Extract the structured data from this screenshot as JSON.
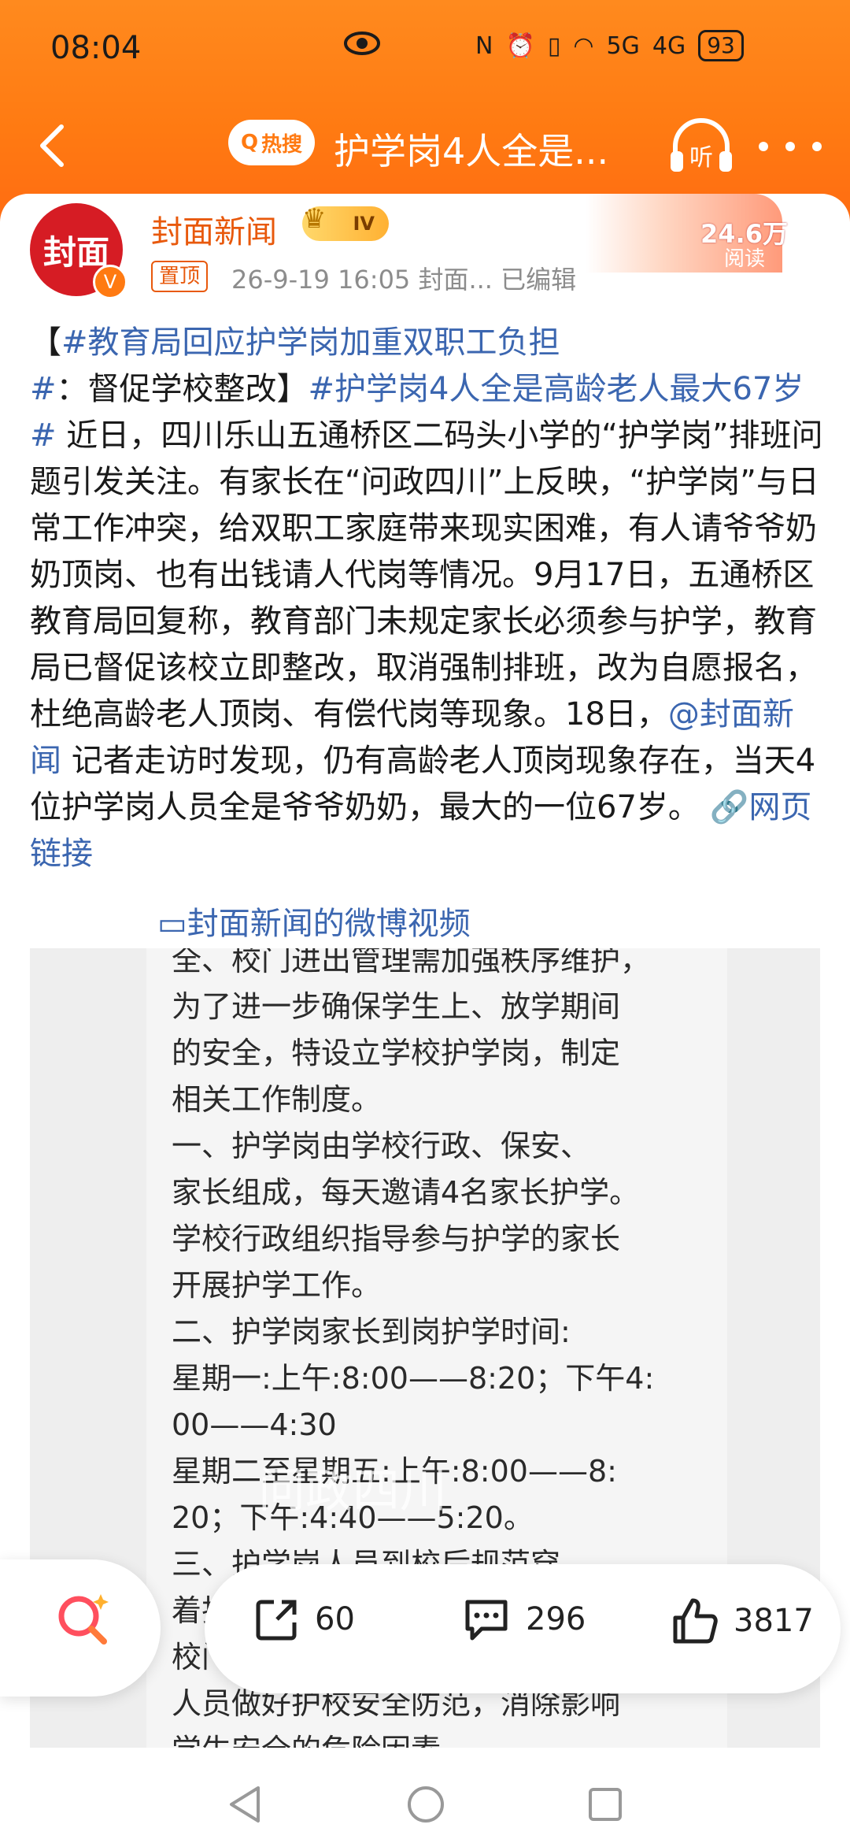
{
  "status_bar": {
    "time": "08:04",
    "net1": "5G",
    "net2": "4G",
    "battery": "93"
  },
  "nav": {
    "hot_label": "热搜",
    "title": "护学岗4人全是...",
    "listen_label": "听"
  },
  "post": {
    "author": "封面新闻",
    "avatar_text": "封面",
    "level": "IV",
    "pinned_label": "置顶",
    "meta": "26-9-19 16:05   封面...   已编辑",
    "reads_value": "24.6万",
    "reads_label": "阅读",
    "text_parts": {
      "p1": "【",
      "tag1": "#教育局回应护学岗加重双职工负担#",
      "p2": "：督促学校整改】",
      "tag2": "#护学岗4人全是高龄老人最大67岁#",
      "p3": " 近日，四川乐山五通桥区二码头小学的“护学岗”排班问题引发关注。有家长在“问政四川”上反映，“护学岗”与日常工作冲突，给双职工家庭带来现实困难，有人请爷爷奶奶顶岗、也有出钱请人代岗等情况。9月17日，五通桥区教育局回复称，教育部门未规定家长必须参与护学，教育局已督促该校立即整改，取消强制排班，改为自愿报名，杜绝高龄老人顶岗、有偿代岗等现象。18日，",
      "mention": "@封面新闻",
      "p4": " 记者走访时发现，仍有高龄老人顶岗现象存在，当天4位护学岗人员全是爷爷奶奶，最大的一位67岁。",
      "web_link": "网页链接",
      "video_link": "封面新闻的微博视频"
    },
    "image_text": "全、校门进出管理需加强秩序维护，\n为了进一步确保学生上、放学期间\n的安全，特设立学校护学岗，制定\n相关工作制度。\n    一、护学岗由学校行政、保安、\n家长组成，每天邀请4名家长护学。\n学校行政组织指导参与护学的家长\n开展护学工作。\n    二、护学岗家长到岗护学时间:\n星期一:上午:8:00——8:20；下午4:\n00——4:30\n星期二至星期五:上午:8:00——8:\n20；下午:4:40——5:20。\n    三、护学岗人员到校后规范穿\n着护学岗专用服装，手持器械，在\n校门口指定区域值守，协助学校安保\n人员做好护校安全防范，消除影响\n学生安全的危险因素。\n    四、护学岗成员值班时不闲谈",
    "watermark": "问政四川"
  },
  "actions": {
    "share_count": "60",
    "comment_count": "296",
    "like_count": "3817"
  },
  "colors": {
    "header": "#ff7a12",
    "link": "#3b66b0",
    "author": "#e8590c"
  }
}
